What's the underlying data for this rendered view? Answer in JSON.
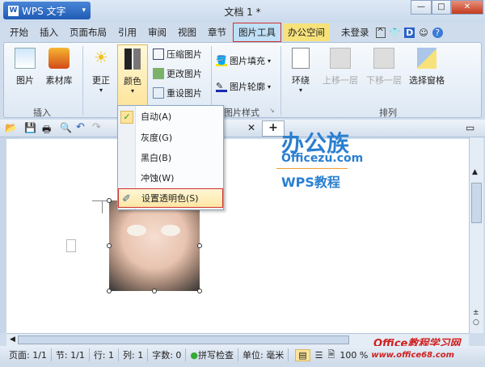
{
  "app": {
    "name": "WPS 文字",
    "logo": "W",
    "doc_title": "文档 1 *"
  },
  "window_buttons": [
    "minimize",
    "maximize",
    "close"
  ],
  "tabs": [
    "开始",
    "插入",
    "页面布局",
    "引用",
    "审阅",
    "视图",
    "章节",
    "图片工具",
    "办公空间"
  ],
  "account": {
    "label": "未登录"
  },
  "ribbon": {
    "insert_group": {
      "label": "插入",
      "picture": "图片",
      "library": "素材库"
    },
    "adjust": {
      "correct": "更正",
      "color": "颜色",
      "compress": "压缩图片",
      "change": "更改图片",
      "reset": "重设图片"
    },
    "style_group": {
      "label": "图片样式",
      "fill": "图片填充",
      "outline": "图片轮廓"
    },
    "arrange_group": {
      "label": "排列",
      "wrap": "环绕",
      "bring_forward": "上移一层",
      "send_backward": "下移一层",
      "selection_pane": "选择窗格"
    }
  },
  "color_menu": {
    "items": [
      "自动(A)",
      "灰度(G)",
      "黑白(B)",
      "冲蚀(W)",
      "设置透明色(S)"
    ],
    "checked": "自动(A)",
    "highlighted": "设置透明色(S)"
  },
  "watermark": {
    "brand": "办公族",
    "site": "Officezu.com",
    "sub": "WPS教程",
    "corner1": "Office教程学习网",
    "corner2": "www.office68.com"
  },
  "status": {
    "page": "页面: 1/1",
    "section": "节: 1/1",
    "row": "行: 1",
    "col": "列: 1",
    "words": "字数: 0",
    "spell": "拼写检查",
    "unit": "单位: 毫米",
    "zoom": "100 %"
  },
  "colors": {
    "accent": "#1f5bb5",
    "highlight_border": "#d03030",
    "office_tab": "#f7e27a"
  }
}
